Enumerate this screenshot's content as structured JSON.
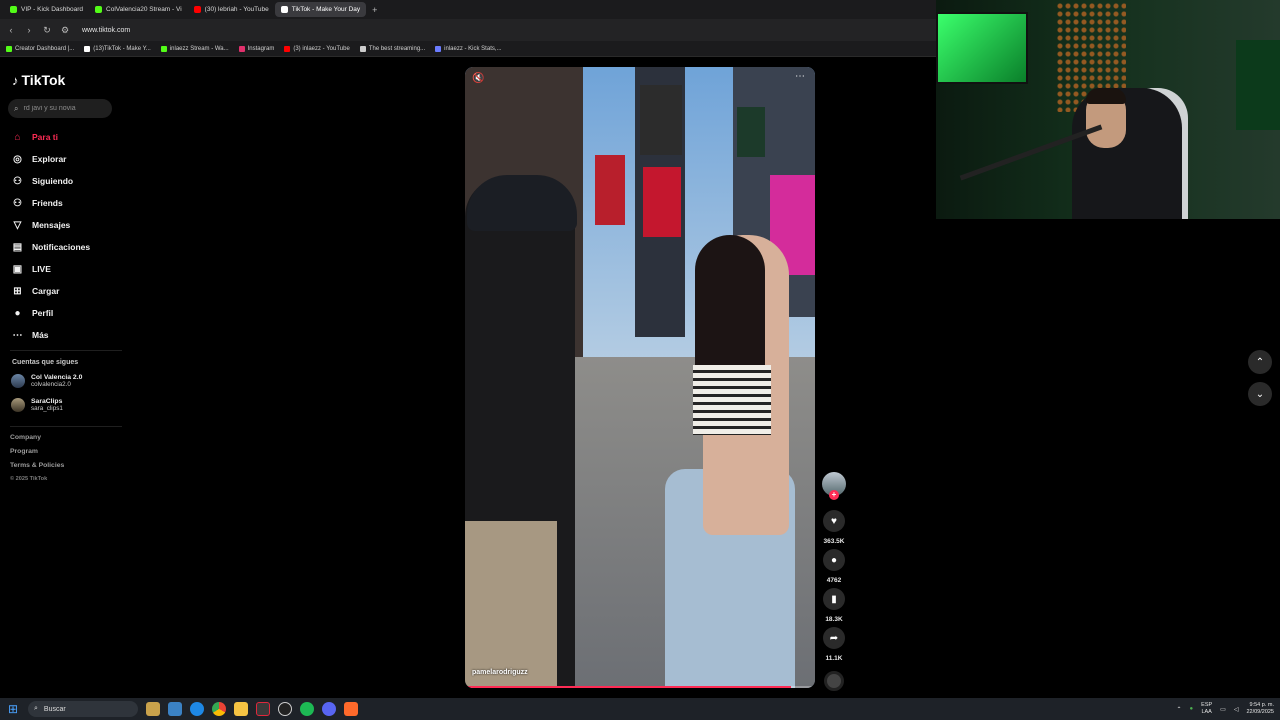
{
  "browser": {
    "tabs": [
      {
        "label": "VIP - Kick Dashboard",
        "color": "#53fc18"
      },
      {
        "label": "ColValencia20 Stream - Vi",
        "color": "#53fc18"
      },
      {
        "label": "(30) lebriah - YouTube",
        "color": "#ff0000"
      },
      {
        "label": "TikTok - Make Your Day",
        "color": "#ffffff"
      }
    ],
    "new_tab_icon": "plus-icon",
    "url": "www.tiktok.com",
    "bookmarks": [
      {
        "label": "Creator Dashboard |...",
        "color": "#53fc18"
      },
      {
        "label": "(13)TikTok - Make Y...",
        "color": "#ffffff"
      },
      {
        "label": "inlaezz Stream - Wa...",
        "color": "#53fc18"
      },
      {
        "label": "Instagram",
        "color": "#e1306c"
      },
      {
        "label": "(3) inlaezz - YouTube",
        "color": "#ff0000"
      },
      {
        "label": "The best streaming...",
        "color": "#cccccc"
      },
      {
        "label": "inlaezz - Kick Stats,...",
        "color": "#6b7cff"
      }
    ]
  },
  "tiktok": {
    "logo": "TikTok",
    "search_placeholder": "rd javi y su novia",
    "nav": [
      {
        "label": "Para ti",
        "icon": "home-icon",
        "active": true
      },
      {
        "label": "Explorar",
        "icon": "compass-icon",
        "active": false
      },
      {
        "label": "Siguiendo",
        "icon": "following-icon",
        "active": false
      },
      {
        "label": "Friends",
        "icon": "friends-icon",
        "active": false
      },
      {
        "label": "Mensajes",
        "icon": "messages-icon",
        "active": false
      },
      {
        "label": "Notificaciones",
        "icon": "notifications-icon",
        "active": false
      },
      {
        "label": "LIVE",
        "icon": "live-icon",
        "active": false
      },
      {
        "label": "Cargar",
        "icon": "upload-icon",
        "active": false
      },
      {
        "label": "Perfil",
        "icon": "profile-icon",
        "active": false
      },
      {
        "label": "Más",
        "icon": "more-icon",
        "active": false
      }
    ],
    "following_label": "Cuentas que sigues",
    "following": [
      {
        "name": "Col Valencia 2.0",
        "handle": "colvalencia2.0"
      },
      {
        "name": "SaraClips",
        "handle": "sara_clips1"
      }
    ],
    "footer": [
      "Company",
      "Program",
      "Terms & Policies"
    ],
    "copyright": "© 2025 TikTok",
    "accent": "#fe2c55"
  },
  "video": {
    "author": "pamelarodriguzz",
    "progress": 0.93,
    "likes": "363.5K",
    "comments": "4762",
    "saves": "18.3K",
    "shares": "11.1K"
  },
  "taskbar": {
    "search_label": "Buscar",
    "lang_top": "ESP",
    "lang_bottom": "LAA",
    "time": "9:54 p. m.",
    "date": "22/09/2025"
  }
}
